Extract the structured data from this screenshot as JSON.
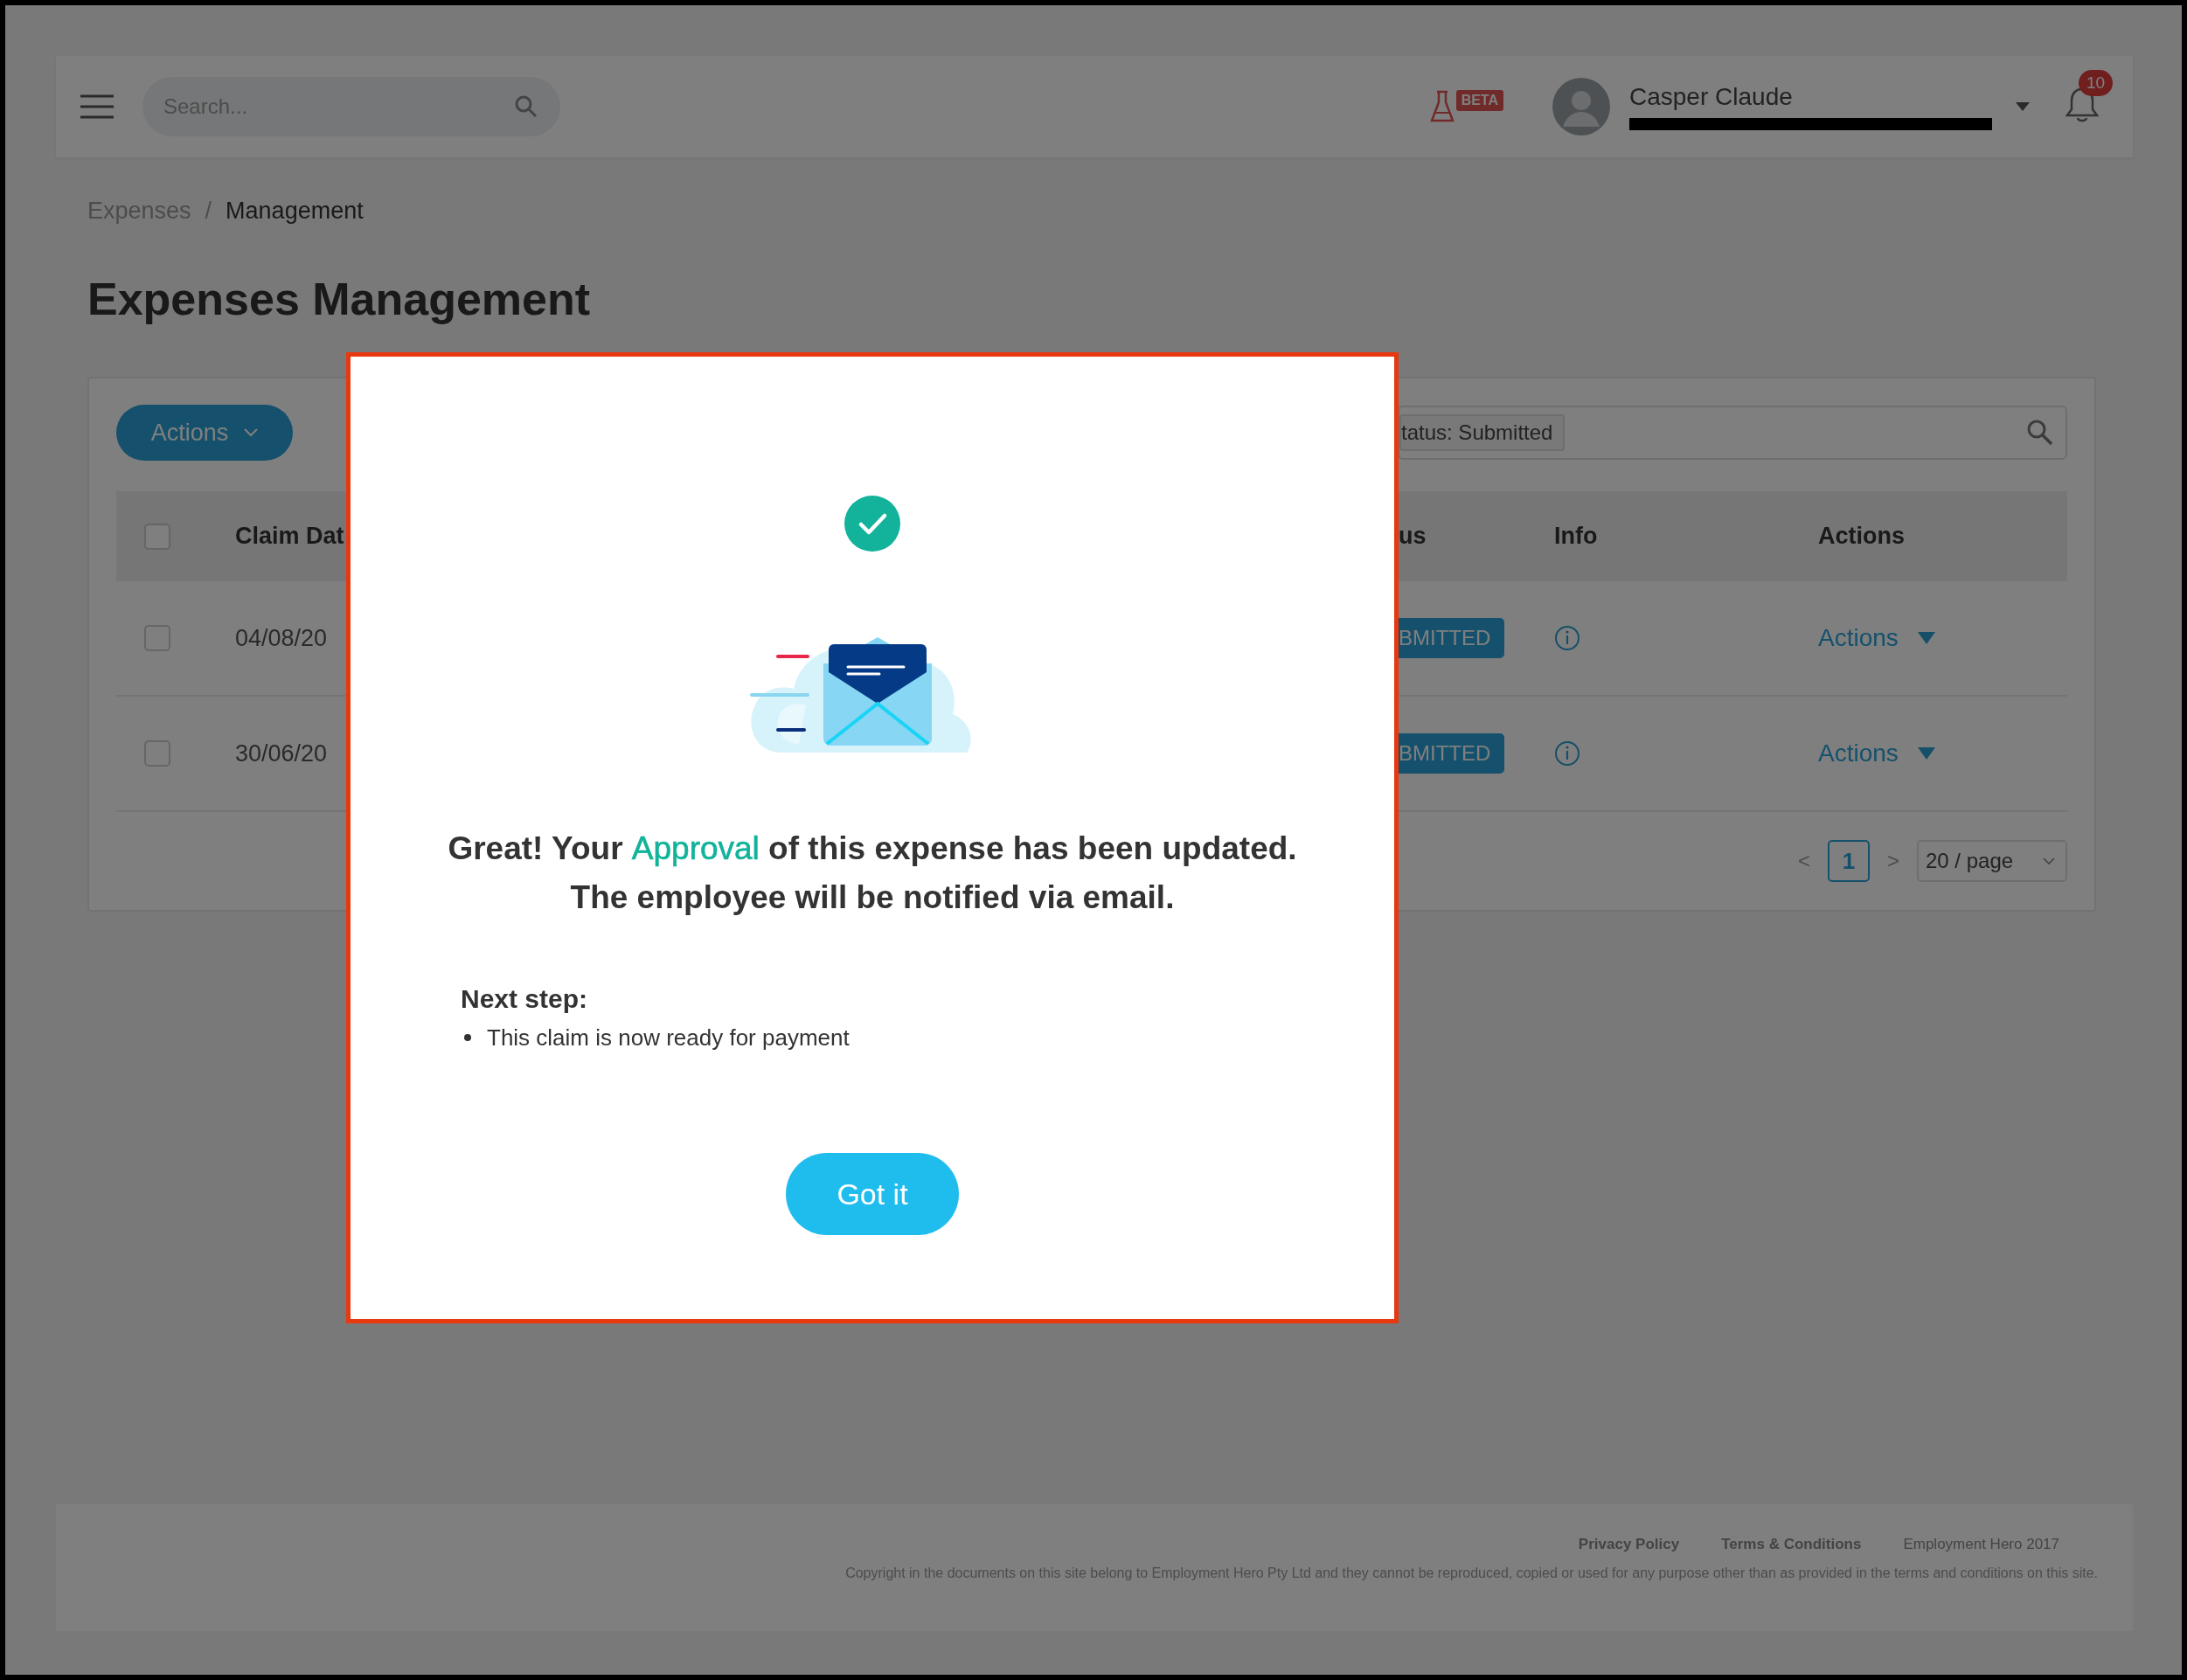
{
  "header": {
    "search_placeholder": "Search...",
    "beta_badge": "BETA",
    "user_name": "Casper Claude",
    "notification_count": "10"
  },
  "breadcrumb": [
    {
      "label": "Expenses",
      "current": false
    },
    {
      "label": "Management",
      "current": true
    }
  ],
  "breadcrumb_separator": "/",
  "page_title": "Expenses Management",
  "toolbar": {
    "actions_button": "Actions",
    "filter_tag": "tatus: Submitted"
  },
  "table": {
    "select_all_checked": false,
    "columns": [
      "Claim Dat",
      "us",
      "Info",
      "Actions"
    ],
    "rows": [
      {
        "checked": false,
        "claim_date": "04/08/20",
        "status": "BMITTED",
        "action": "Actions"
      },
      {
        "checked": false,
        "claim_date": "30/06/20",
        "status": "BMITTED",
        "action": "Actions"
      }
    ]
  },
  "pagination": {
    "prev": "<",
    "pages": [
      {
        "label": "1",
        "selected": true
      }
    ],
    "next": ">",
    "page_size": "20 / page"
  },
  "footer": {
    "links": [
      "Privacy Policy",
      "Terms & Conditions"
    ],
    "brand": "Employment Hero 2017",
    "copyright": "Copyright in the documents on this site belong to Employment Hero Pty Ltd and they cannot be reproduced, copied or used for any purpose other than as provided in the terms and conditions on this site."
  },
  "modal": {
    "message_lines": [
      "Great! Your **Approval** of this expense has been updated.",
      "The employee will be notified via email."
    ],
    "next_step_title": "Next step:",
    "next_steps": [
      "This claim is now ready for payment"
    ],
    "button": "Got it"
  }
}
